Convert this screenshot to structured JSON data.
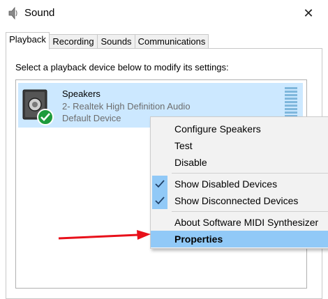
{
  "window": {
    "title": "Sound",
    "close_glyph": "✕"
  },
  "tabs": [
    {
      "label": "Playback",
      "active": true
    },
    {
      "label": "Recording",
      "active": false
    },
    {
      "label": "Sounds",
      "active": false
    },
    {
      "label": "Communications",
      "active": false
    }
  ],
  "instruction": "Select a playback device below to modify its settings:",
  "device": {
    "name": "Speakers",
    "description": "2- Realtek High Definition Audio",
    "status": "Default Device",
    "icon": "speaker-icon",
    "status_icon": "checkmark-badge-icon"
  },
  "context_menu": {
    "items": [
      {
        "label": "Configure Speakers"
      },
      {
        "label": "Test"
      },
      {
        "label": "Disable"
      },
      {
        "label": "Show Disabled Devices",
        "checked": true
      },
      {
        "label": "Show Disconnected Devices",
        "checked": true
      },
      {
        "label": "About Software MIDI Synthesizer"
      },
      {
        "label": "Properties",
        "highlighted": true
      }
    ]
  },
  "colors": {
    "selection": "#cce8ff",
    "menu_highlight": "#91c9f7",
    "annotation_arrow": "#e8101a",
    "check_badge": "#1e9b3c"
  }
}
